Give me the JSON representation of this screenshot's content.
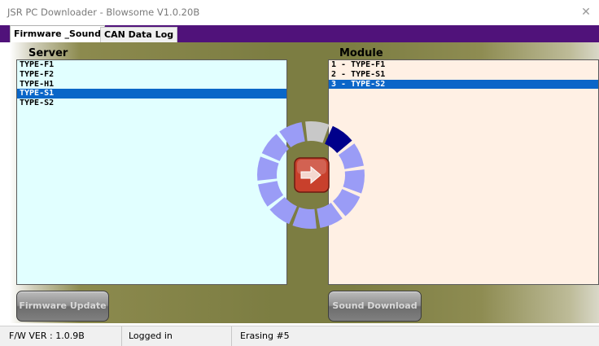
{
  "window": {
    "title": "JSR PC Downloader - Blowsome V1.0.20B",
    "close_glyph": "✕"
  },
  "tabs": [
    {
      "label": "Firmware _Sound",
      "active": true
    },
    {
      "label": "CAN Data Log",
      "active": false
    }
  ],
  "server": {
    "label": "Server",
    "items": [
      "TYPE-F1",
      "TYPE-F2",
      "TYPE-H1",
      "TYPE-S1",
      "TYPE-S2"
    ],
    "selected_index": 3
  },
  "module": {
    "label": "Module",
    "items": [
      "1 - TYPE-F1",
      "2 - TYPE-S1",
      "3 - TYPE-S2"
    ],
    "selected_index": 2
  },
  "buttons": {
    "firmware_update": "Firmware Update",
    "sound_download": "Sound Download"
  },
  "progress_wheel": {
    "segments": 12,
    "icon": "arrow-right-icon",
    "colors": {
      "idle": "#9a9cf6",
      "active": "#00008b",
      "trail": "#c8c8c8",
      "button": "#c8402c"
    }
  },
  "status": {
    "fw_version": "F/W VER : 1.0.9B",
    "login": "Logged in",
    "operation": "Erasing #5"
  }
}
